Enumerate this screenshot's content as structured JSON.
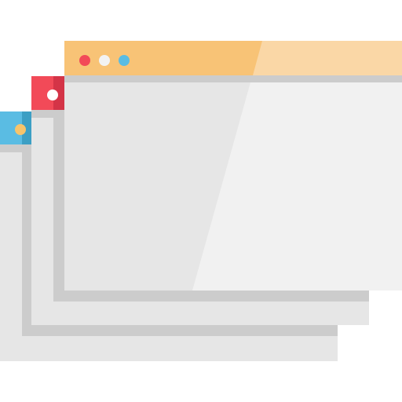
{
  "illustration": {
    "icon": "stacked-browser-windows-icon",
    "colors": {
      "back_window_accent": "#5ABCE3",
      "back_window_accent_dark": "#3C9FC4",
      "back_window_dot": "#F6C46B",
      "middle_window_accent": "#F24A58",
      "middle_window_accent_dark": "#D43447",
      "middle_window_dot": "#FFFFFF",
      "front_titlebar": "#F8C376",
      "front_titlebar_light": "#FAD7A6",
      "dot_red": "#F24A58",
      "dot_white": "#F2F2F2",
      "dot_blue": "#5ABCE3",
      "window_gray_light": "#E6E6E6",
      "window_gray_lighter": "#F1F1F1",
      "window_gray_shadow": "#CCCCCC"
    }
  }
}
